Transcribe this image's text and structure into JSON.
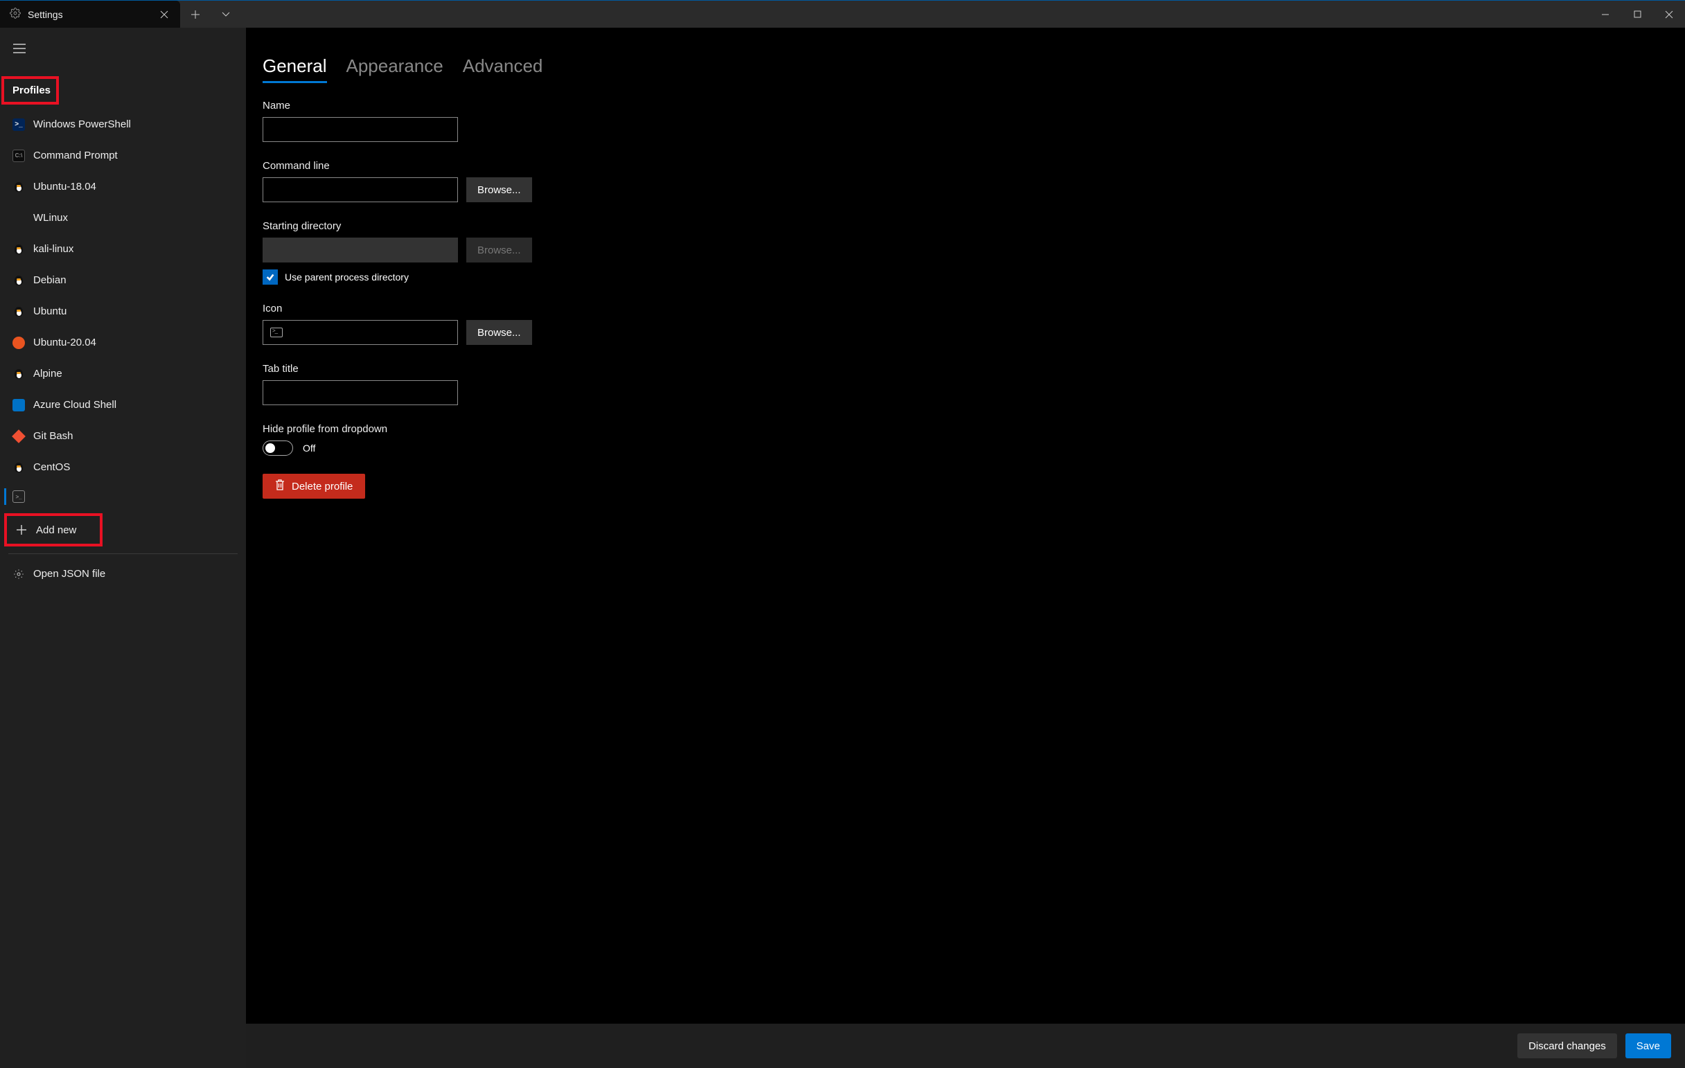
{
  "titlebar": {
    "tab_title": "Settings"
  },
  "sidebar": {
    "section_label": "Profiles",
    "items": [
      {
        "label": "Windows PowerShell",
        "icon": "powershell"
      },
      {
        "label": "Command Prompt",
        "icon": "cmd"
      },
      {
        "label": "Ubuntu-18.04",
        "icon": "tux"
      },
      {
        "label": "WLinux",
        "icon": "none"
      },
      {
        "label": "kali-linux",
        "icon": "tux"
      },
      {
        "label": "Debian",
        "icon": "tux"
      },
      {
        "label": "Ubuntu",
        "icon": "tux"
      },
      {
        "label": "Ubuntu-20.04",
        "icon": "ubuntu"
      },
      {
        "label": "Alpine",
        "icon": "tux"
      },
      {
        "label": "Azure Cloud Shell",
        "icon": "azure"
      },
      {
        "label": "Git Bash",
        "icon": "git"
      },
      {
        "label": "CentOS",
        "icon": "tux"
      }
    ],
    "active_item_icon": "square",
    "add_new_label": "Add new",
    "open_json_label": "Open JSON file"
  },
  "content": {
    "tabs": {
      "general": "General",
      "appearance": "Appearance",
      "advanced": "Advanced"
    },
    "fields": {
      "name_label": "Name",
      "name_value": "",
      "commandline_label": "Command line",
      "commandline_value": "",
      "browse_label": "Browse...",
      "startdir_label": "Starting directory",
      "startdir_value": "",
      "use_parent_label": "Use parent process directory",
      "use_parent_checked": true,
      "icon_label": "Icon",
      "icon_value": "",
      "tabtitle_label": "Tab title",
      "tabtitle_value": "",
      "hide_label": "Hide profile from dropdown",
      "hide_state_label": "Off",
      "delete_label": "Delete profile"
    }
  },
  "footer": {
    "discard_label": "Discard changes",
    "save_label": "Save"
  }
}
